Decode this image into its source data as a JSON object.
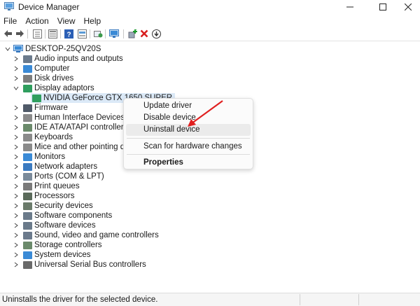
{
  "window": {
    "title": "Device Manager"
  },
  "menu": [
    "File",
    "Action",
    "View",
    "Help"
  ],
  "toolbar": {
    "icons": [
      "back-arrow-icon",
      "forward-arrow-icon",
      "tree-view-icon",
      "properties-sheet-icon",
      "help-icon",
      "list-view-icon",
      "refresh-icon",
      "monitor-icon",
      "add-driver-icon",
      "uninstall-x-icon",
      "download-driver-icon"
    ],
    "uninstall_color": "#d81e1e",
    "add_color": "#1a9a2c"
  },
  "tree": {
    "root": "DESKTOP-25QV20S",
    "categories": [
      {
        "label": "Audio inputs and outputs",
        "icon": "speaker-icon",
        "color": "#6b7a8c"
      },
      {
        "label": "Computer",
        "icon": "computer-icon",
        "color": "#3a8ad6"
      },
      {
        "label": "Disk drives",
        "icon": "disk-drive-icon",
        "color": "#7d7d7d"
      },
      {
        "label": "Display adaptors",
        "icon": "display-adapter-icon",
        "color": "#2f9e5e",
        "expanded": true
      },
      {
        "label": "Firmware",
        "icon": "firmware-icon",
        "color": "#505a68"
      },
      {
        "label": "Human Interface Devices",
        "icon": "hid-icon",
        "color": "#8a8a8a"
      },
      {
        "label": "IDE ATA/ATAPI controllers",
        "icon": "ide-controller-icon",
        "color": "#6b8a6b"
      },
      {
        "label": "Keyboards",
        "icon": "keyboard-icon",
        "color": "#8a8a8a"
      },
      {
        "label": "Mice and other pointing devices",
        "icon": "mouse-icon",
        "color": "#8a8a8a"
      },
      {
        "label": "Monitors",
        "icon": "monitor-icon",
        "color": "#3a8ad6"
      },
      {
        "label": "Network adapters",
        "icon": "network-adapter-icon",
        "color": "#3a7ac0"
      },
      {
        "label": "Ports (COM & LPT)",
        "icon": "port-icon",
        "color": "#7a8a9a"
      },
      {
        "label": "Print queues",
        "icon": "printer-icon",
        "color": "#7a7a7a"
      },
      {
        "label": "Processors",
        "icon": "processor-icon",
        "color": "#5a6a5a"
      },
      {
        "label": "Security devices",
        "icon": "security-device-icon",
        "color": "#6a7a6a"
      },
      {
        "label": "Software components",
        "icon": "software-component-icon",
        "color": "#6a7a8a"
      },
      {
        "label": "Software devices",
        "icon": "software-device-icon",
        "color": "#6a7a8a"
      },
      {
        "label": "Sound, video and game controllers",
        "icon": "sound-controller-icon",
        "color": "#6b7a8c"
      },
      {
        "label": "Storage controllers",
        "icon": "storage-controller-icon",
        "color": "#6b8a6b"
      },
      {
        "label": "System devices",
        "icon": "system-device-icon",
        "color": "#3a8ad6"
      },
      {
        "label": "Universal Serial Bus controllers",
        "icon": "usb-controller-icon",
        "color": "#6a6a6a"
      }
    ],
    "child_device": "NVIDIA GeForce GTX 1650 SUPER"
  },
  "context_menu": {
    "items": [
      "Update driver",
      "Disable device",
      "Uninstall device",
      "Scan for hardware changes",
      "Properties"
    ],
    "highlighted": "Uninstall device"
  },
  "annotation": {
    "arrow_color": "#e02020"
  },
  "status": {
    "text": "Uninstalls the driver for the selected device."
  },
  "colors": {
    "selection": "#dbe9f7",
    "accent": "#0067c0"
  }
}
